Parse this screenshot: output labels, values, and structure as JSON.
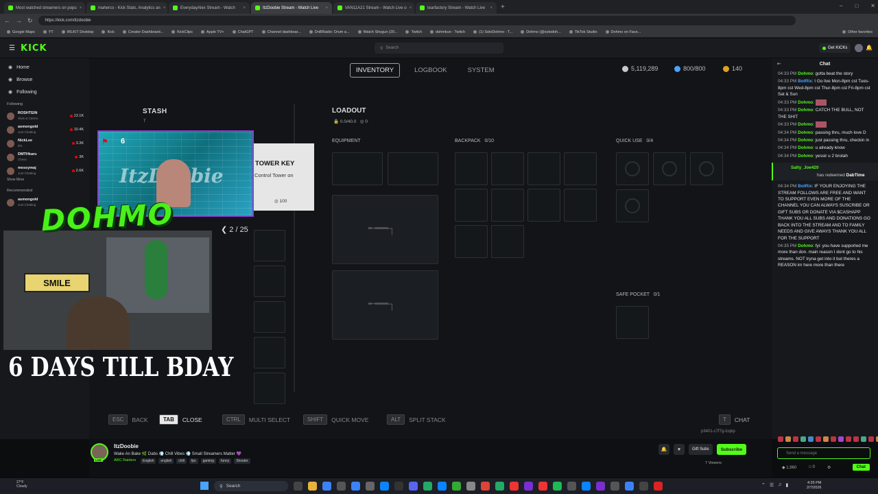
{
  "browser": {
    "tabs": [
      {
        "title": "Most watched streamers on popu"
      },
      {
        "title": "maherco - Kick Stats, Analytics an"
      },
      {
        "title": "EverydayAlex Stream - Watch"
      },
      {
        "title": "ItzDoobie Stream - Watch Live",
        "active": true
      },
      {
        "title": "VAN11A21 Stream - Watch Live o"
      },
      {
        "title": "tearfactory Stream - Watch Live"
      }
    ],
    "url": "https://kick.com/itzdoobie",
    "bookmarks": [
      "Google Maps",
      "YT",
      "IRLKIT Desktop",
      "Kick",
      "Creator Dashboard...",
      "KickClips",
      "Apple TV+",
      "ChatGPT",
      "Channel dashboar...",
      "DnBRadio: Drum a...",
      "Watch Shogun (20...",
      "Twitch",
      "dohmkun - Twitch",
      "(1) SoloDohmo - T...",
      "Dohmo (@solodoh...",
      "TikTok Studio",
      "Dohmo on Face..."
    ],
    "other_favorites": "Other favorites"
  },
  "kick": {
    "logo": "KICK",
    "search_placeholder": "Search",
    "get_kicks": "Get KICKs",
    "nav": [
      {
        "label": "Home",
        "icon": "home-icon"
      },
      {
        "label": "Browse",
        "icon": "compass-icon"
      },
      {
        "label": "Following",
        "icon": "heart-icon"
      }
    ],
    "following_header": "Following",
    "following": [
      {
        "name": "ROSHTEIN",
        "cat": "Slots & Casino",
        "viewers": "13.1K"
      },
      {
        "name": "asmongold",
        "cat": "Just Chatting",
        "viewers": "10.4K"
      },
      {
        "name": "NickLee",
        "cat": "IRL",
        "viewers": "3.3K"
      },
      {
        "name": "DMTHkaru",
        "cat": "Chess",
        "viewers": "3K"
      },
      {
        "name": "messymaj",
        "cat": "Just Chatting",
        "viewers": "2.6K"
      }
    ],
    "show_more": "Show More",
    "recommended_header": "Recommended",
    "recommended": [
      {
        "name": "asmongold",
        "cat": "Just Chatting"
      }
    ]
  },
  "game": {
    "tabs": [
      "INVENTORY",
      "LOGBOOK",
      "SYSTEM"
    ],
    "currency": [
      {
        "value": "5,119,289",
        "color": "#c9c9c9"
      },
      {
        "value": "800/800",
        "color": "#4aa3ff"
      },
      {
        "value": "140",
        "color": "#e0a020"
      }
    ],
    "stash_title": "STASH",
    "stash_count": "7",
    "loadout_title": "LOADOUT",
    "loadout_weight": "0.0/40.0",
    "loadout_other": "0",
    "equipment": "EQUIPMENT",
    "backpack": "BACKPACK",
    "backpack_count": "0/10",
    "quick_use": "QUICK USE",
    "quick_use_count": "0/4",
    "safe_pocket": "SAFE POCKET",
    "safe_pocket_count": "0/1",
    "tooltip": {
      "title": "TOWER KEY",
      "subtitle": "Control Tower on",
      "price": "100"
    },
    "badge_count": "6",
    "page": "2 / 25",
    "controls": [
      {
        "key": "ESC",
        "label": "BACK"
      },
      {
        "key": "TAB",
        "label": "CLOSE",
        "highlight": true
      },
      {
        "key": "CTRL",
        "label": "MULTI SELECT"
      },
      {
        "key": "SHIFT",
        "label": "QUICK MOVE"
      },
      {
        "key": "ALT",
        "label": "SPLIT STACK"
      }
    ],
    "chat_label": "CHAT",
    "session_id": "p3401-c7f7g-tcqkp"
  },
  "overlay": {
    "dohmo": "DOHMO",
    "smile": "SMILE",
    "bday": "6 DAYS TILL BDAY"
  },
  "chat": {
    "title": "Chat",
    "messages": [
      {
        "time": "04:33 PM",
        "user": "Dohmo",
        "text": "gotta beat the story"
      },
      {
        "time": "04:33 PM",
        "user": "BotRix",
        "bot": true,
        "text": "I Go live Mon-8pm cst Tues-8pm cst Wed-8pm cst Thur-8pm cst Fri-8pm cst Sat & Sun"
      },
      {
        "time": "04:33 PM",
        "user": "Dohmo",
        "text": ""
      },
      {
        "time": "04:33 PM",
        "user": "Dohmo",
        "text": "CATCH THE BULL, NOT THE SHIT"
      },
      {
        "time": "04:33 PM",
        "user": "Dohmo",
        "text": ""
      },
      {
        "time": "04:34 PM",
        "user": "Dohmo",
        "text": "passing thru, much love D"
      },
      {
        "time": "04:34 PM",
        "user": "Dohmo",
        "text": "just passing thru, checkin in"
      },
      {
        "time": "04:34 PM",
        "user": "Dohmo",
        "text": "u already know"
      },
      {
        "time": "04:34 PM",
        "user": "Dohmo",
        "text": "yessir u 2 brotah"
      }
    ],
    "redeem": {
      "user": "Salty_Joe420",
      "action": "has redeemed",
      "reward": "DabTime"
    },
    "messages2": [
      {
        "time": "04:34 PM",
        "user": "BotRix",
        "bot": true,
        "text": "IF YOUR ENJOYING THE STREAM FOLLOWS ARE FREE AND WANT TO SUPPORT EVEN MORE OF THE CHANNEL YOU CAN ALWAYS SUSCRIBE OR GIFT SUBS OR DONATE VIA $CASHAPP THANK YOU ALL SUBS AND DONATIONS GO BACK INTO THE STREAM AND TO FAMILY NEEDS AND GIVE AWAYS THANK YOU ALL FOR THE SUPPORT"
      },
      {
        "time": "04:35 PM",
        "user": "Dohmo",
        "text": "fyi: you have supported me more than don. main reason I dont go to his streams. NOT tryna get into it but theres a REASON im here more than there"
      }
    ],
    "send_placeholder": "Send a message",
    "kicks_count": "1,960",
    "other_count": "0",
    "chat_button": "Chat"
  },
  "streamer": {
    "name": "ItzDoobie",
    "title": "Wake An Bake 🌿 Dabs 💨 Chill Vibes 💨 Small Streamers Matter 💜",
    "category": "ARC Raiders",
    "tags": [
      "English",
      "english",
      "chill",
      "fps",
      "gaming",
      "funny",
      "Shooter"
    ],
    "gift_subs": "Gift Subs",
    "subscribe": "Subscribe",
    "viewers": "7 Viewers"
  },
  "taskbar": {
    "temp": "27°F",
    "weather": "Cloudy",
    "search": "Search",
    "time": "4:35 PM",
    "date": "2/7/2026"
  }
}
